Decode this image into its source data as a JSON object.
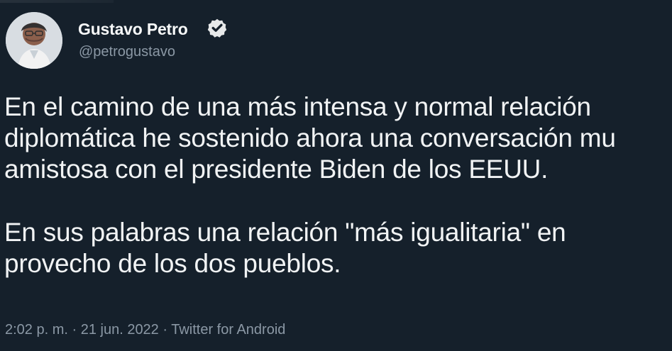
{
  "tweet": {
    "author_name": "Gustavo Petro",
    "handle": "@petrogustavo",
    "text_lines": [
      "En el camino de una más intensa y normal relación",
      "diplomática he sostenido ahora una conversación mu",
      "amistosa con el presidente Biden de los EEUU.",
      "En sus palabras una relación \"más igualitaria\" en",
      "provecho de los dos pueblos."
    ],
    "meta": "2:02 p. m. · 21 jun. 2022 · Twitter for Android",
    "verified_icon": "verified-badge-icon",
    "colors": {
      "background": "#15202b",
      "primary_text": "#f1f3f4",
      "secondary_text": "#8b98a5",
      "verified_badge": "#e7e9ea"
    }
  }
}
